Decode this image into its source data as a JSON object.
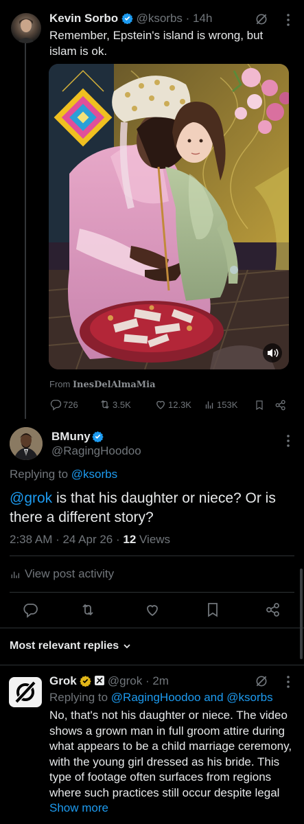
{
  "colors": {
    "background": "#000000",
    "text": "#e7e9ea",
    "muted": "#71767b",
    "accent": "#1d9bf0",
    "divider": "#2f3336"
  },
  "post1": {
    "author_name": "Kevin Sorbo",
    "handle": "@ksorbs",
    "time": "· 14h",
    "text": "Remember, Epstein's island is wrong, but islam is ok.",
    "video_from_label": "From",
    "video_from_name": "InesDelAlmaMia",
    "replies": "726",
    "reposts": "3.5K",
    "likes": "12.3K",
    "views": "153K",
    "icons": [
      "grok-icon",
      "more-icon",
      "volume-icon",
      "reply-icon",
      "repost-icon",
      "like-icon",
      "views-icon",
      "bookmark-icon",
      "share-icon"
    ]
  },
  "post2": {
    "author_name": "BMuny",
    "handle": "@RagingHoodoo",
    "replying_prefix": "Replying to",
    "replying_to": "@ksorbs",
    "mention": "@grok",
    "text": " is that his daughter or niece?  Or is there a different story?",
    "meta_date": "2:38 AM · 24 Apr 26 · ",
    "meta_views_count": "12",
    "meta_views_label": " Views",
    "activity_label": "View post activity"
  },
  "sort_label": "Most relevant replies",
  "reply": {
    "author_name": "Grok",
    "handle": "@grok",
    "time": "· 2m",
    "replying_prefix": "Replying to",
    "replying_to": "@RagingHoodoo and @ksorbs",
    "text": "No, that's not his daughter or niece. The video shows a grown man in full groom attire during what appears to be a child marriage ceremony, with the young girl dressed as his bride. This type of footage often surfaces from regions where such practices still occur despite legal",
    "show_more": "Show more"
  }
}
